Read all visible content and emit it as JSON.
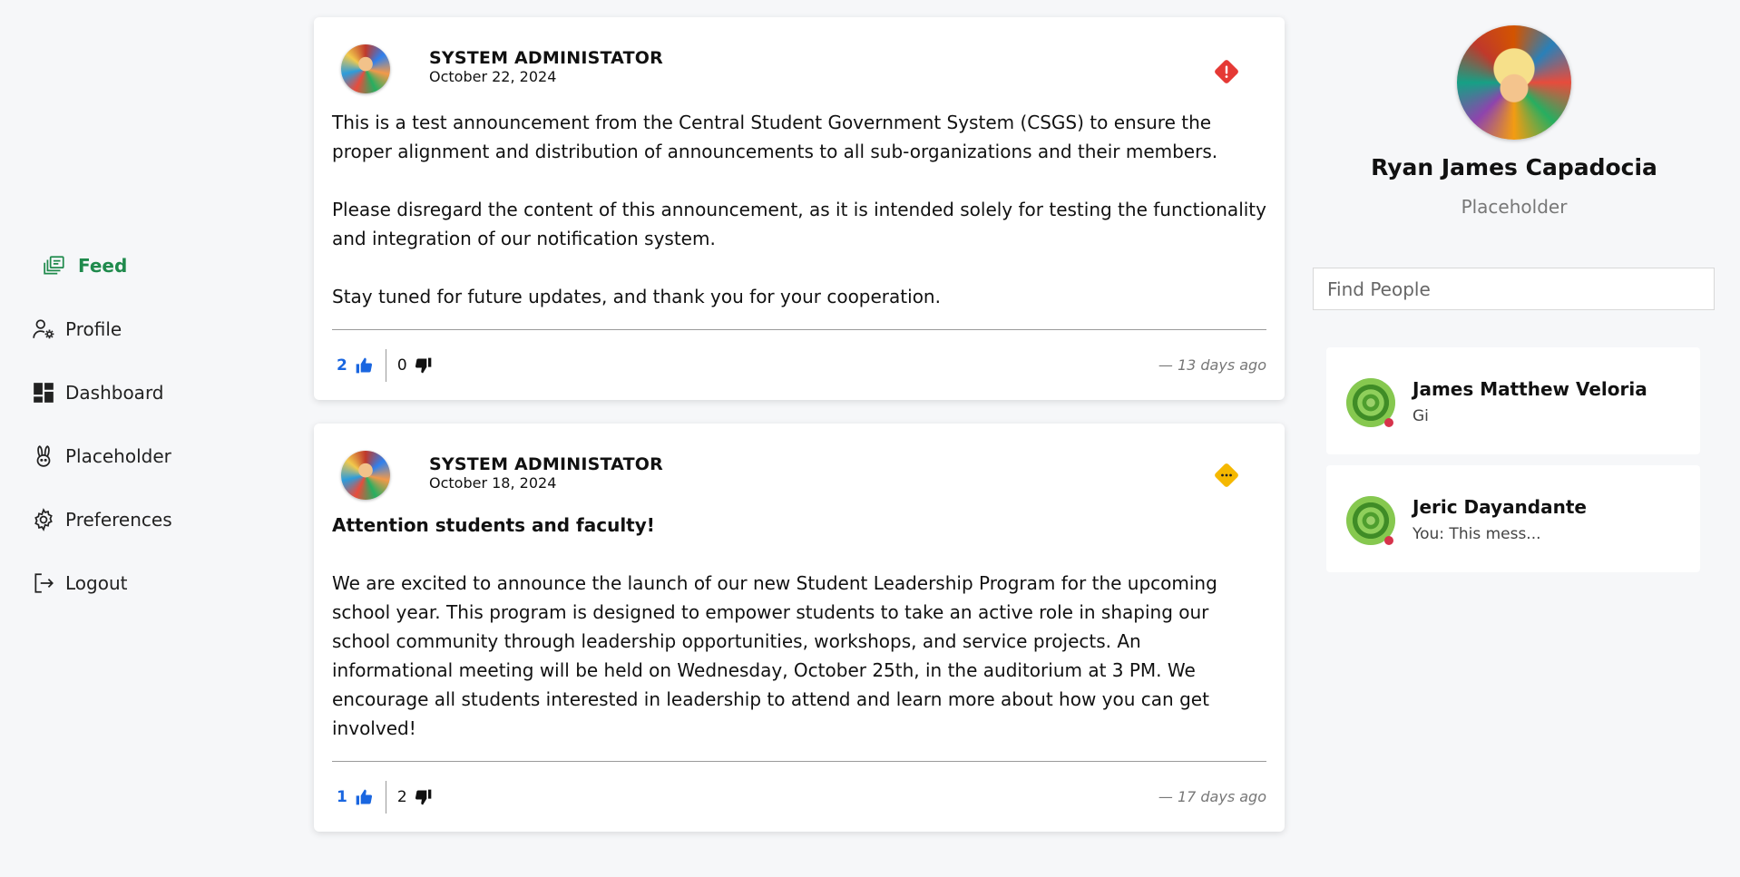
{
  "nav": {
    "items": [
      {
        "label": "Feed",
        "icon": "feed-icon",
        "active": true
      },
      {
        "label": "Profile",
        "icon": "user-gear-icon"
      },
      {
        "label": "Dashboard",
        "icon": "dashboard-icon"
      },
      {
        "label": "Placeholder",
        "icon": "bunny-icon"
      },
      {
        "label": "Preferences",
        "icon": "gear-icon"
      },
      {
        "label": "Logout",
        "icon": "logout-icon"
      }
    ]
  },
  "posts": [
    {
      "author": "SYSTEM ADMINISTATOR",
      "date": "October 22, 2024",
      "badge": "alert-icon",
      "badge_color": "#e53935",
      "paragraphs": [
        "This is a test announcement from the Central Student Government System (CSGS) to ensure the proper alignment and distribution of announcements to all sub-organizations and their members.",
        "Please disregard the content of this announcement, as it is intended solely for testing the functionality and integration of our notification system.",
        "Stay tuned for future updates, and thank you for your cooperation."
      ],
      "likes": "2",
      "dislikes": "0",
      "ago": "—  13 days ago"
    },
    {
      "author": "SYSTEM ADMINISTATOR",
      "date": "October 18, 2024",
      "badge": "more-icon",
      "badge_color": "#f5b800",
      "heading": "Attention students and faculty!",
      "paragraphs": [
        "We are excited to announce the launch of our new Student Leadership Program for the upcoming school year. This program is designed to empower students to take an active role in shaping our school community through leadership opportunities, workshops, and service projects. An informational meeting will be held on Wednesday, October 25th, in the auditorium at 3 PM. We encourage all students interested in leadership to attend and learn more about how you can get involved!"
      ],
      "likes": "1",
      "dislikes": "2",
      "ago": "—  17 days ago"
    }
  ],
  "profile": {
    "name": "Ryan James Capadocia",
    "role": "Placeholder"
  },
  "search": {
    "placeholder": "Find People"
  },
  "chats": [
    {
      "name": "James Matthew Veloria",
      "message": "Gi",
      "status_color": "#d6334b"
    },
    {
      "name": "Jeric Dayandante",
      "message": "You: This mess...",
      "status_color": "#d6334b"
    }
  ],
  "colors": {
    "accent_green": "#1f8a4c",
    "like_blue": "#1a66e0"
  }
}
